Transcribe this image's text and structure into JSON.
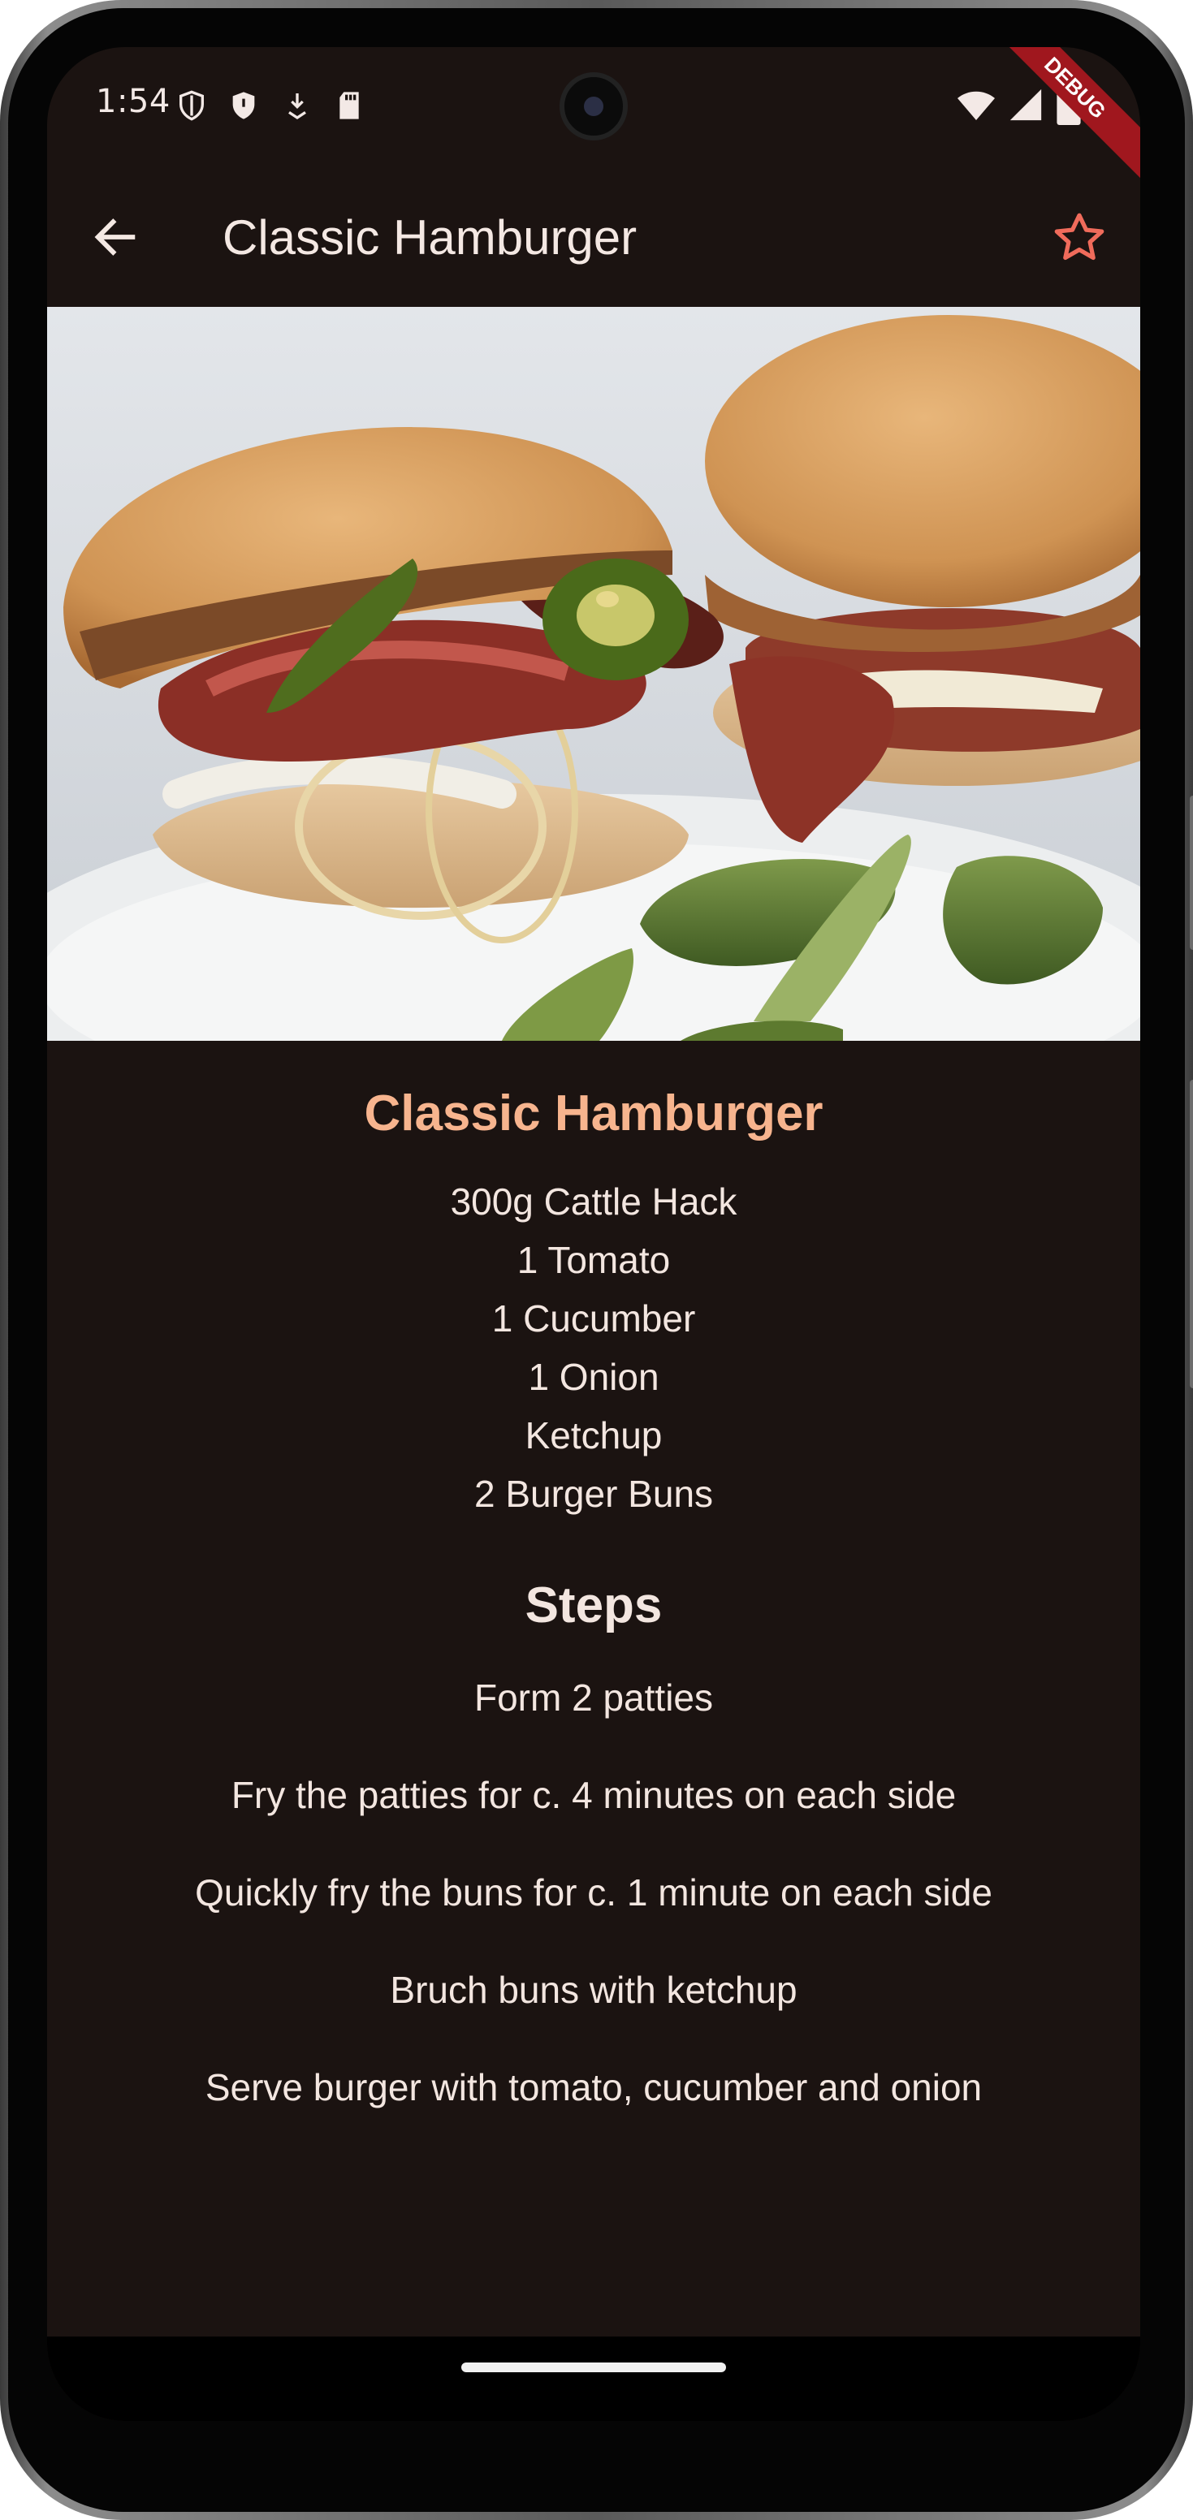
{
  "status_bar": {
    "time": "1:54",
    "left_icons": [
      "shield-outline-icon",
      "shield-icon",
      "download-icon",
      "sd-card-icon"
    ],
    "right_icons": [
      "wifi-icon",
      "cell-signal-icon",
      "battery-icon"
    ]
  },
  "debug_banner": "DEBUG",
  "app_bar": {
    "title": "Classic Hamburger",
    "back_icon": "arrow-back-icon",
    "favorite_icon": "star-outline-icon",
    "favorite_color": "#f06b5b"
  },
  "recipe": {
    "title": "Classic Hamburger",
    "title_color": "#f7b48e",
    "ingredients": [
      "300g Cattle Hack",
      "1 Tomato",
      "1 Cucumber",
      "1 Onion",
      "Ketchup",
      "2 Burger Buns"
    ],
    "steps_heading": "Steps",
    "steps": [
      "Form 2 patties",
      "Fry the patties for c. 4 minutes on each side",
      "Quickly fry the buns for c. 1 minute on each side",
      "Bruch buns with ketchup",
      "Serve burger with tomato, cucumber and onion"
    ]
  },
  "colors": {
    "background": "#1b1311",
    "text": "#f3e6e0"
  }
}
